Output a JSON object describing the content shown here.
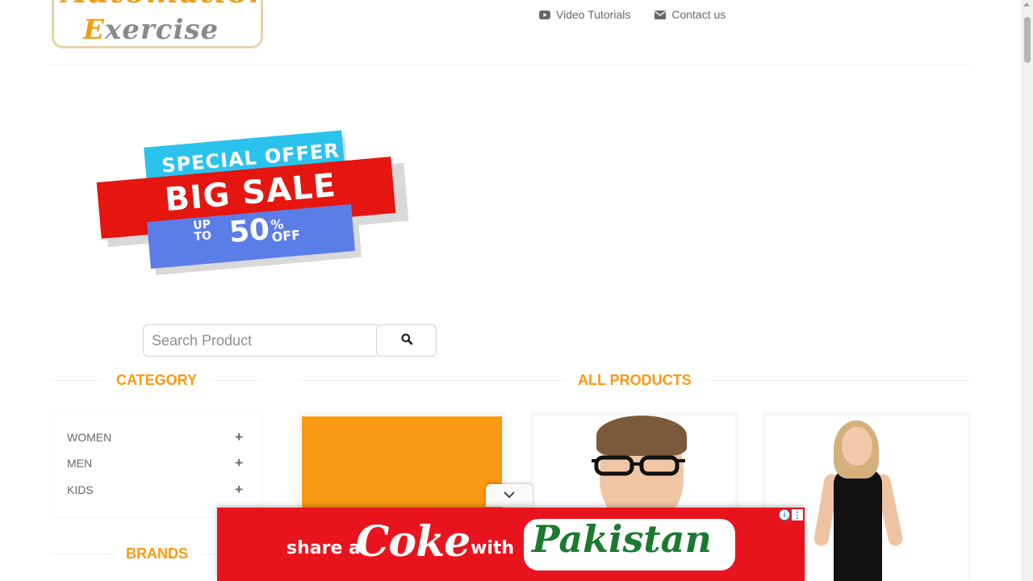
{
  "logo": {
    "line1": "Automation",
    "line2_cap": "E",
    "line2_rest": "xercise"
  },
  "nav": {
    "items": [
      {
        "label": "Video Tutorials",
        "icon": "youtube-icon"
      },
      {
        "label": "Contact us",
        "icon": "envelope-icon"
      }
    ]
  },
  "banner": {
    "line1": "SPECIAL OFFER",
    "line2": "BIG SALE",
    "up": "UP",
    "to": "TO",
    "percent_value": "50",
    "percent_sign": "%",
    "off": "OFF",
    "colors": {
      "cyan": "#2bc3ee",
      "red": "#e4160f",
      "blue": "#5b7de8"
    }
  },
  "search": {
    "placeholder": "Search Product",
    "value": ""
  },
  "sidebar": {
    "category_title": "Category",
    "categories": [
      {
        "label": "WOMEN",
        "icon": "plus-icon"
      },
      {
        "label": "MEN",
        "icon": "plus-icon"
      },
      {
        "label": "KIDS",
        "icon": "plus-icon"
      }
    ],
    "brands_title": "Brands"
  },
  "main": {
    "title": "All Products"
  },
  "ad": {
    "share": "share a",
    "brand": "Coke",
    "with": "with",
    "country": "Pakistan",
    "info": "i",
    "menu": "⋮",
    "background": "#e8141d"
  },
  "colors": {
    "accent": "#fe980f",
    "text": "#696763"
  }
}
